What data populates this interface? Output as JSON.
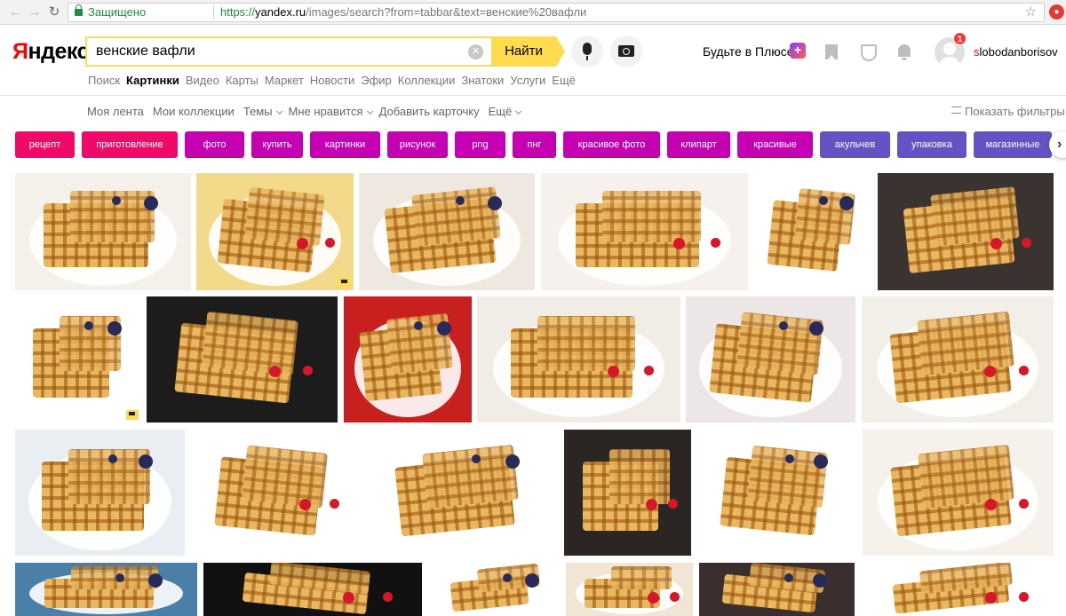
{
  "browser": {
    "secure_label": "Защищено",
    "url_prefix": "https://",
    "url_host": "yandex.ru",
    "url_path": "/images/search?from=tabbar&text=венские%20вафли"
  },
  "header": {
    "logo_first": "Я",
    "logo_rest": "ндекс",
    "search_value": "венские вафли",
    "find_label": "Найти",
    "plus_label": "Будьте в Плюсе",
    "notifications_count": "1",
    "username_first": "s",
    "username_rest": "lobodanborisov"
  },
  "services": [
    "Поиск",
    "Картинки",
    "Видео",
    "Карты",
    "Маркет",
    "Новости",
    "Эфир",
    "Коллекции",
    "Знатоки",
    "Услуги",
    "Ещё"
  ],
  "services_active": 1,
  "subnav": {
    "items": [
      "Моя лента",
      "Мои коллекции",
      "Темы",
      "Мне нравится",
      "Добавить карточку",
      "Ещё"
    ],
    "filters_label": "Показать фильтры"
  },
  "tags": [
    {
      "label": "рецепт",
      "color": "#ef0a6a"
    },
    {
      "label": "приготовление",
      "color": "#ef0a6a"
    },
    {
      "label": "фото",
      "color": "#c400b2"
    },
    {
      "label": "купить",
      "color": "#c400b2"
    },
    {
      "label": "картинки",
      "color": "#c400b2"
    },
    {
      "label": "рисунок",
      "color": "#c400b2"
    },
    {
      "label": "png",
      "color": "#c400b2"
    },
    {
      "label": "пнг",
      "color": "#c400b2"
    },
    {
      "label": "красивое фото",
      "color": "#c400b2"
    },
    {
      "label": "клипарт",
      "color": "#c400b2"
    },
    {
      "label": "красивые",
      "color": "#c400b2"
    },
    {
      "label": "акульчев",
      "color": "#6453c4"
    },
    {
      "label": "упаковка",
      "color": "#6453c4"
    },
    {
      "label": "магазинные",
      "color": "#6453c4"
    }
  ],
  "images": [
    {
      "name": "waffle-image",
      "bg": "#f4f0ea",
      "dark": false,
      "cart": false
    },
    {
      "name": "waffle-image",
      "bg": "#f3d98a",
      "dark": false,
      "cart": true
    },
    {
      "name": "waffle-image",
      "bg": "#eee8e0",
      "dark": false,
      "cart": false
    },
    {
      "name": "waffle-image",
      "bg": "#f6f1ec",
      "dark": false,
      "cart": false
    },
    {
      "name": "waffle-image",
      "bg": "#ffffff",
      "dark": false,
      "cart": false
    },
    {
      "name": "waffle-image",
      "bg": "#3a3330",
      "dark": true,
      "cart": false
    },
    {
      "name": "waffle-image",
      "bg": "#ffffff",
      "dark": false,
      "cart": true
    },
    {
      "name": "waffle-image",
      "bg": "#1c1c1c",
      "dark": true,
      "cart": false
    },
    {
      "name": "waffle-image",
      "bg": "#c8201e",
      "dark": false,
      "cart": false
    },
    {
      "name": "waffle-image",
      "bg": "#f2ece6",
      "dark": false,
      "cart": false
    },
    {
      "name": "waffle-image",
      "bg": "#ece6e6",
      "dark": false,
      "cart": false
    },
    {
      "name": "waffle-image",
      "bg": "#f2eee8",
      "dark": false,
      "cart": false
    },
    {
      "name": "waffle-image",
      "bg": "#e9eef2",
      "dark": false,
      "cart": false
    },
    {
      "name": "waffle-image",
      "bg": "#ffffff",
      "dark": false,
      "cart": false
    },
    {
      "name": "waffle-image",
      "bg": "#ffffff",
      "dark": false,
      "cart": false
    },
    {
      "name": "waffle-image",
      "bg": "#2b2624",
      "dark": true,
      "cart": false
    },
    {
      "name": "waffle-image",
      "bg": "#ffffff",
      "dark": false,
      "cart": false
    },
    {
      "name": "waffle-image",
      "bg": "#f6f1ea",
      "dark": false,
      "cart": false
    },
    {
      "name": "waffle-image",
      "bg": "#4a7fa8",
      "dark": false,
      "cart": false
    },
    {
      "name": "waffle-image",
      "bg": "#111111",
      "dark": true,
      "cart": false
    },
    {
      "name": "waffle-image",
      "bg": "#ffffff",
      "dark": false,
      "cart": false
    },
    {
      "name": "waffle-image",
      "bg": "#f1e6d6",
      "dark": false,
      "cart": false
    },
    {
      "name": "waffle-image",
      "bg": "#3a2f2c",
      "dark": true,
      "cart": false
    },
    {
      "name": "waffle-image",
      "bg": "#ffffff",
      "dark": false,
      "cart": false
    }
  ]
}
